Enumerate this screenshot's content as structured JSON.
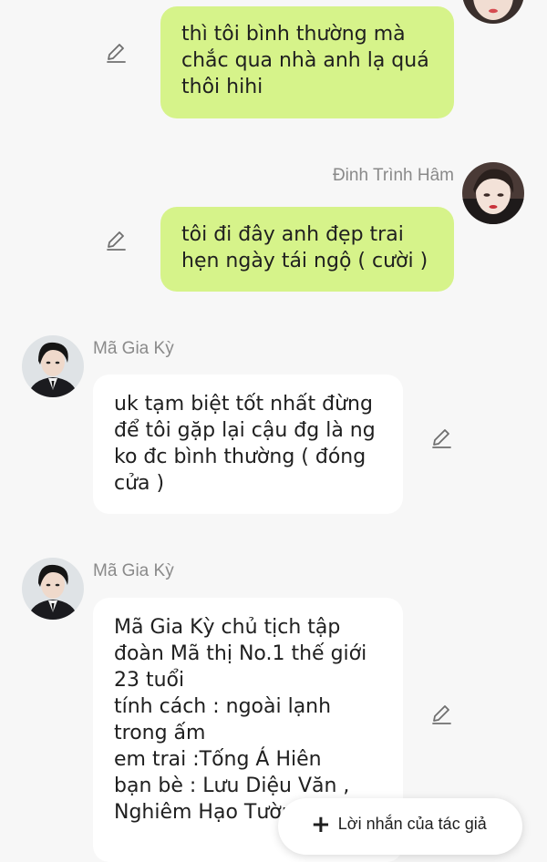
{
  "messages": [
    {
      "id": "m1",
      "direction": "outgoing",
      "text": "thì tôi bình thường mà\nchắc qua nhà anh lạ quá\nthôi hihi"
    },
    {
      "id": "m2",
      "direction": "outgoing",
      "sender": "Đinh Trình Hâm",
      "text": "tôi đi đây anh đẹp trai\nhẹn ngày tái ngộ ( cười )"
    },
    {
      "id": "m3",
      "direction": "incoming",
      "sender": "Mã Gia Kỳ",
      "text": "uk tạm biệt tốt nhất đừng\nđể tôi gặp lại cậu đg là ng\nko đc bình thường ( đóng\ncửa )"
    },
    {
      "id": "m4",
      "direction": "incoming",
      "sender": "Mã Gia Kỳ",
      "text": "Mã Gia Kỳ chủ tịch tập\nđoàn  Mã thị No.1 thế giới\n23 tuổi\ntính cách : ngoài lạnh\ntrong ấm\nem trai :Tống Á Hiên\nbạn bè : Lưu Diệu Văn ,\nNghiêm Hạo Tường"
    }
  ],
  "fab": {
    "icon": "plus-icon",
    "label": "Lời nhắn của tác giả"
  },
  "colors": {
    "outgoing_bubble": "#d6f38a",
    "incoming_bubble": "#ffffff",
    "background": "#f7f7f7",
    "sender_name": "#8a8a8a"
  }
}
